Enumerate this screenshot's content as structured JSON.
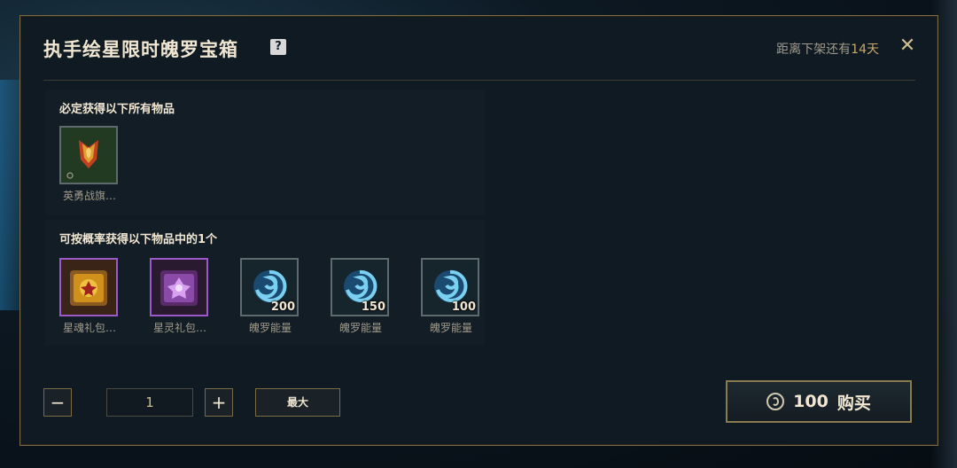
{
  "modal": {
    "title": "执手绘星限时魄罗宝箱",
    "help_icon": "?",
    "countdown_prefix": "距离下架还有",
    "countdown_days": "14天",
    "close_icon": "✕"
  },
  "guaranteed": {
    "title": "必定获得以下所有物品",
    "items": [
      {
        "label": "英勇战旗…",
        "icon": "banner-icon"
      }
    ]
  },
  "random": {
    "title": "可按概率获得以下物品中的1个",
    "items": [
      {
        "label": "星魂礼包…",
        "icon": "gift-chest-icon",
        "qty": ""
      },
      {
        "label": "星灵礼包…",
        "icon": "gift-chest-icon",
        "qty": ""
      },
      {
        "label": "魄罗能量",
        "icon": "swirl-energy-icon",
        "qty": "200"
      },
      {
        "label": "魄罗能量",
        "icon": "swirl-energy-icon",
        "qty": "150"
      },
      {
        "label": "魄罗能量",
        "icon": "swirl-energy-icon",
        "qty": "100"
      }
    ]
  },
  "controls": {
    "minus": "−",
    "quantity": "1",
    "plus": "+",
    "max": "最大"
  },
  "buy": {
    "price": "100",
    "label": "购买",
    "currency_icon": "coin-icon"
  },
  "colors": {
    "gold": "#c8aa6e",
    "text": "#f0e6d2",
    "purple_border": "#9a5ac8",
    "panel": "#0f1a22"
  }
}
